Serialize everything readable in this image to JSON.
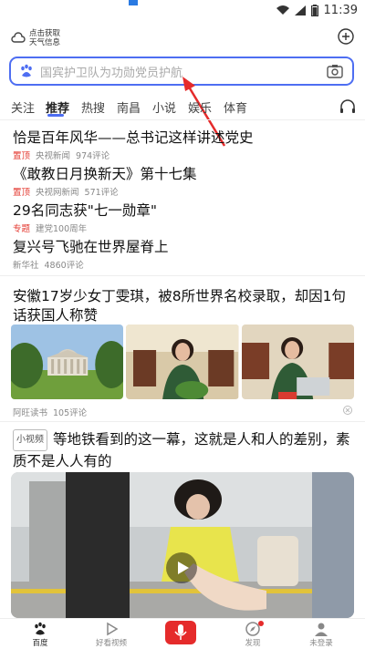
{
  "status_bar": {
    "time": "11:39"
  },
  "weather": {
    "line1": "点击获取",
    "line2": "天气信息"
  },
  "search": {
    "placeholder": "国宾护卫队为功勋党员护航"
  },
  "tabs": [
    "关注",
    "推荐",
    "热搜",
    "南昌",
    "小说",
    "娱乐",
    "体育"
  ],
  "active_tab": "推荐",
  "news": [
    {
      "title": "恰是百年风华——总书记这样讲述党史",
      "tag": "置顶",
      "source": "央视新闻",
      "comments": "974评论"
    },
    {
      "title": "《敢教日月换新天》第十七集",
      "tag": "置顶",
      "source": "央视网新闻",
      "comments": "571评论"
    },
    {
      "title": "29名同志获\"七一勋章\"",
      "tag": "专题",
      "source": "建党100周年",
      "comments": ""
    },
    {
      "title": "复兴号飞驰在世界屋脊上",
      "tag": "",
      "source": "新华社",
      "comments": "4860评论"
    }
  ],
  "article": {
    "title": "安徽17岁少女丁雯琪，被8所世界名校录取，却因1句话获国人称赞",
    "source": "阿旺读书",
    "comments": "105评论"
  },
  "video": {
    "badge": "小视频",
    "title": "等地铁看到的这一幕，这就是人和人的差别，素质不是人人有的"
  },
  "bottom_nav": {
    "home": "百度",
    "video": "好看视频",
    "discover": "发现",
    "profile": "未登录"
  },
  "colors": {
    "accent": "#4e6ef2",
    "tag_red": "#e3352c",
    "mic_red": "#e52b2b"
  }
}
